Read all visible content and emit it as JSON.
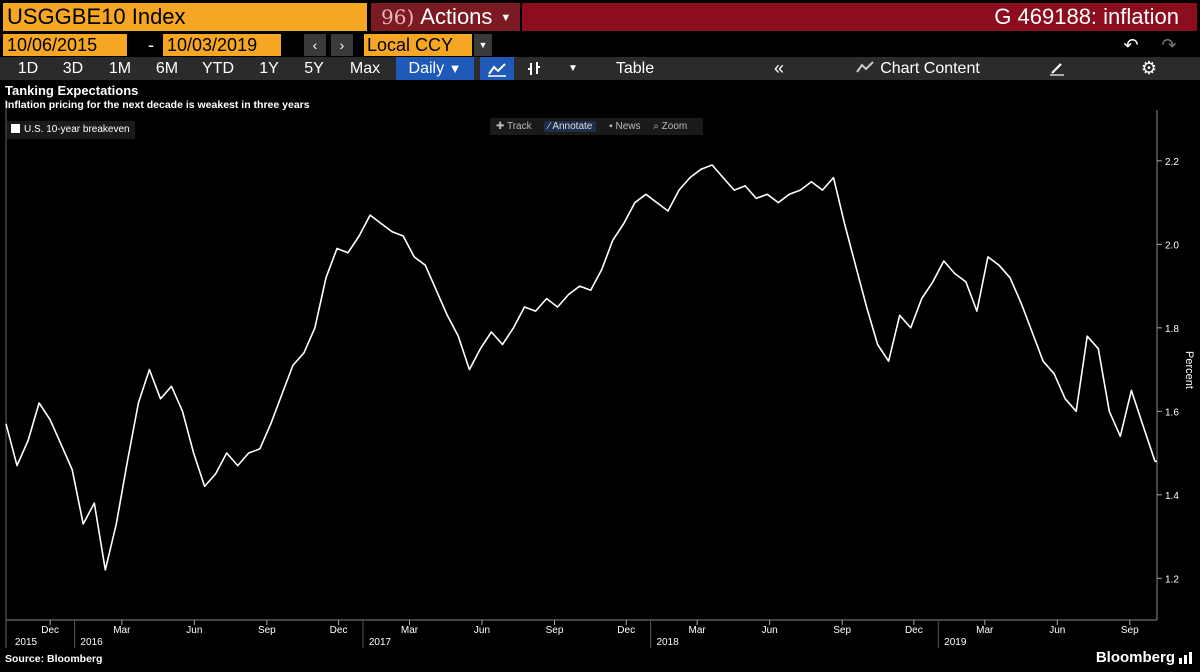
{
  "toolbar": {
    "ticker": "USGGBE10 Index",
    "actions_num": "96)",
    "actions_label": "Actions",
    "graph_id": "G 469188: inflation",
    "start_date": "10/06/2015",
    "end_date": "10/03/2019",
    "date_separator": "-",
    "currency": "Local CCY",
    "ranges": [
      "1D",
      "3D",
      "1M",
      "6M",
      "YTD",
      "1Y",
      "5Y",
      "Max"
    ],
    "frequency": "Daily",
    "table_label": "Table",
    "chart_content_label": "Chart Content"
  },
  "chart_tools": [
    "Track",
    "Annotate",
    "News",
    "Zoom"
  ],
  "colors": {
    "orange": "#f5a623",
    "maroon": "#8c0d1d",
    "blue": "#1f5ab8",
    "line": "#ffffff"
  },
  "footer": {
    "source": "Source: Bloomberg",
    "brand": "Bloomberg"
  },
  "chart_data": {
    "type": "line",
    "title": "Tanking Expectations",
    "subtitle": "Inflation pricing for the next decade is weakest in three years",
    "ylabel": "Percent",
    "ylim": [
      1.1,
      2.25
    ],
    "yticks": [
      1.2,
      1.4,
      1.6,
      1.8,
      2.0,
      2.2
    ],
    "ytick_labels": [
      "1.2",
      "1.4",
      "1.6",
      "1.8",
      "2.0",
      "2.2"
    ],
    "legend_position": "top-left",
    "grid": false,
    "last_value": 1.48,
    "series": [
      {
        "name": "U.S. 10-year breakeven",
        "x": [
          "2015-10-06",
          "2015-10-20",
          "2015-11-03",
          "2015-11-17",
          "2015-12-01",
          "2015-12-15",
          "2015-12-29",
          "2016-01-12",
          "2016-01-26",
          "2016-02-09",
          "2016-02-23",
          "2016-03-08",
          "2016-03-22",
          "2016-04-05",
          "2016-04-19",
          "2016-05-03",
          "2016-05-17",
          "2016-05-31",
          "2016-06-14",
          "2016-06-28",
          "2016-07-12",
          "2016-07-26",
          "2016-08-09",
          "2016-08-23",
          "2016-09-06",
          "2016-09-20",
          "2016-10-04",
          "2016-10-18",
          "2016-11-01",
          "2016-11-15",
          "2016-11-29",
          "2016-12-13",
          "2016-12-27",
          "2017-01-10",
          "2017-01-24",
          "2017-02-07",
          "2017-02-21",
          "2017-03-07",
          "2017-03-21",
          "2017-04-04",
          "2017-04-18",
          "2017-05-02",
          "2017-05-16",
          "2017-05-30",
          "2017-06-13",
          "2017-06-27",
          "2017-07-11",
          "2017-07-25",
          "2017-08-08",
          "2017-08-22",
          "2017-09-05",
          "2017-09-19",
          "2017-10-03",
          "2017-10-17",
          "2017-10-31",
          "2017-11-14",
          "2017-11-28",
          "2017-12-12",
          "2017-12-26",
          "2018-01-09",
          "2018-01-23",
          "2018-02-06",
          "2018-02-20",
          "2018-03-06",
          "2018-03-20",
          "2018-04-03",
          "2018-04-17",
          "2018-05-01",
          "2018-05-15",
          "2018-05-29",
          "2018-06-12",
          "2018-06-26",
          "2018-07-10",
          "2018-07-24",
          "2018-08-07",
          "2018-08-21",
          "2018-09-04",
          "2018-09-18",
          "2018-10-02",
          "2018-10-16",
          "2018-10-30",
          "2018-11-13",
          "2018-11-27",
          "2018-12-11",
          "2018-12-25",
          "2019-01-08",
          "2019-01-22",
          "2019-02-05",
          "2019-02-19",
          "2019-03-05",
          "2019-03-19",
          "2019-04-02",
          "2019-04-16",
          "2019-04-30",
          "2019-05-14",
          "2019-05-28",
          "2019-06-11",
          "2019-06-25",
          "2019-07-09",
          "2019-07-23",
          "2019-08-06",
          "2019-08-20",
          "2019-09-03",
          "2019-09-17",
          "2019-10-03"
        ],
        "values": [
          1.57,
          1.47,
          1.53,
          1.62,
          1.58,
          1.52,
          1.46,
          1.33,
          1.38,
          1.22,
          1.33,
          1.48,
          1.62,
          1.7,
          1.63,
          1.66,
          1.6,
          1.5,
          1.42,
          1.45,
          1.5,
          1.47,
          1.5,
          1.51,
          1.57,
          1.64,
          1.71,
          1.74,
          1.8,
          1.92,
          1.99,
          1.98,
          2.02,
          2.07,
          2.05,
          2.03,
          2.02,
          1.97,
          1.95,
          1.89,
          1.83,
          1.78,
          1.7,
          1.75,
          1.79,
          1.76,
          1.8,
          1.85,
          1.84,
          1.87,
          1.85,
          1.88,
          1.9,
          1.89,
          1.94,
          2.01,
          2.05,
          2.1,
          2.12,
          2.1,
          2.08,
          2.13,
          2.16,
          2.18,
          2.19,
          2.16,
          2.13,
          2.14,
          2.11,
          2.12,
          2.1,
          2.12,
          2.13,
          2.15,
          2.13,
          2.16,
          2.05,
          1.95,
          1.85,
          1.76,
          1.72,
          1.83,
          1.8,
          1.87,
          1.91,
          1.96,
          1.93,
          1.91,
          1.84,
          1.97,
          1.95,
          1.92,
          1.86,
          1.79,
          1.72,
          1.69,
          1.63,
          1.6,
          1.78,
          1.75,
          1.6,
          1.54,
          1.65,
          1.57,
          1.48
        ]
      }
    ],
    "x_tick_labels": [
      {
        "date": "2015-12-01",
        "label": "Dec"
      },
      {
        "date": "2016-03-01",
        "label": "Mar"
      },
      {
        "date": "2016-06-01",
        "label": "Jun"
      },
      {
        "date": "2016-09-01",
        "label": "Sep"
      },
      {
        "date": "2016-12-01",
        "label": "Dec"
      },
      {
        "date": "2017-03-01",
        "label": "Mar"
      },
      {
        "date": "2017-06-01",
        "label": "Jun"
      },
      {
        "date": "2017-09-01",
        "label": "Sep"
      },
      {
        "date": "2017-12-01",
        "label": "Dec"
      },
      {
        "date": "2018-03-01",
        "label": "Mar"
      },
      {
        "date": "2018-06-01",
        "label": "Jun"
      },
      {
        "date": "2018-09-01",
        "label": "Sep"
      },
      {
        "date": "2018-12-01",
        "label": "Dec"
      },
      {
        "date": "2019-03-01",
        "label": "Mar"
      },
      {
        "date": "2019-06-01",
        "label": "Jun"
      },
      {
        "date": "2019-09-01",
        "label": "Sep"
      }
    ],
    "year_labels": [
      {
        "date": "2015-10-06",
        "label": "2015"
      },
      {
        "date": "2016-01-01",
        "label": "2016"
      },
      {
        "date": "2017-01-01",
        "label": "2017"
      },
      {
        "date": "2018-01-01",
        "label": "2018"
      },
      {
        "date": "2019-01-01",
        "label": "2019"
      }
    ]
  }
}
